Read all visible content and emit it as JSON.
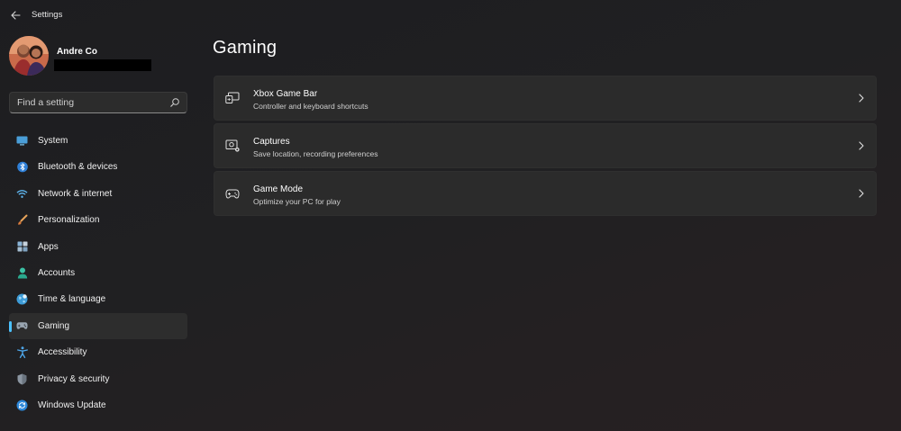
{
  "window": {
    "title": "Settings"
  },
  "user": {
    "name": "Andre Co"
  },
  "search": {
    "placeholder": "Find a setting"
  },
  "sidebar": {
    "items": [
      {
        "label": "System",
        "icon": "system-icon"
      },
      {
        "label": "Bluetooth & devices",
        "icon": "bluetooth-icon"
      },
      {
        "label": "Network & internet",
        "icon": "wifi-icon"
      },
      {
        "label": "Personalization",
        "icon": "brush-icon"
      },
      {
        "label": "Apps",
        "icon": "apps-icon"
      },
      {
        "label": "Accounts",
        "icon": "person-icon"
      },
      {
        "label": "Time & language",
        "icon": "globe-icon"
      },
      {
        "label": "Gaming",
        "icon": "gamepad-icon",
        "selected": true
      },
      {
        "label": "Accessibility",
        "icon": "accessibility-icon"
      },
      {
        "label": "Privacy & security",
        "icon": "shield-icon"
      },
      {
        "label": "Windows Update",
        "icon": "update-icon"
      }
    ]
  },
  "main": {
    "title": "Gaming",
    "cards": [
      {
        "title": "Xbox Game Bar",
        "subtitle": "Controller and keyboard shortcuts",
        "icon": "game-bar-icon"
      },
      {
        "title": "Captures",
        "subtitle": "Save location, recording preferences",
        "icon": "capture-icon"
      },
      {
        "title": "Game Mode",
        "subtitle": "Optimize your PC for play",
        "icon": "game-mode-icon"
      }
    ]
  },
  "colors": {
    "accent": "#4cc2ff",
    "background": "#202020",
    "card": "#2b2b2b"
  }
}
